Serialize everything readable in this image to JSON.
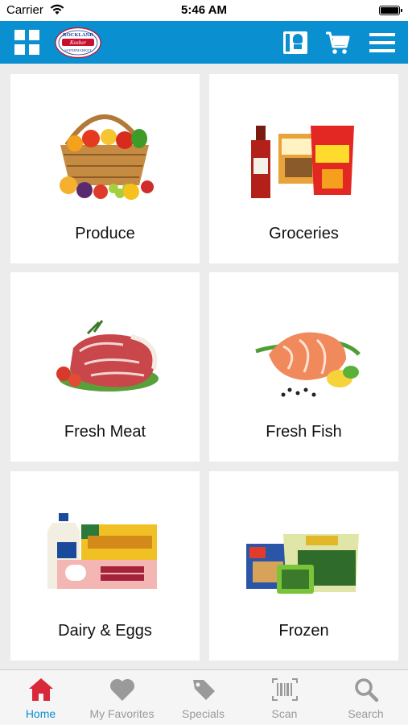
{
  "status_bar": {
    "carrier": "Carrier",
    "time": "5:46 AM"
  },
  "header": {
    "logo_text_top": "ROCKLAND",
    "logo_text_middle": "Kosher",
    "logo_text_bottom": "SUPERMARKET"
  },
  "categories": [
    {
      "label": "Produce"
    },
    {
      "label": "Groceries"
    },
    {
      "label": "Fresh Meat"
    },
    {
      "label": "Fresh Fish"
    },
    {
      "label": "Dairy & Eggs"
    },
    {
      "label": "Frozen"
    }
  ],
  "tabs": [
    {
      "label": "Home",
      "icon": "home-icon",
      "active": true
    },
    {
      "label": "My Favorites",
      "icon": "heart-icon",
      "active": false
    },
    {
      "label": "Specials",
      "icon": "tag-icon",
      "active": false
    },
    {
      "label": "Scan",
      "icon": "barcode-icon",
      "active": false
    },
    {
      "label": "Search",
      "icon": "magnifier-icon",
      "active": false
    }
  ],
  "colors": {
    "brand_blue": "#0a8fd1",
    "tab_active": "#0a8fd1",
    "tab_inactive": "#9a9a9a",
    "home_icon": "#d9283a"
  }
}
